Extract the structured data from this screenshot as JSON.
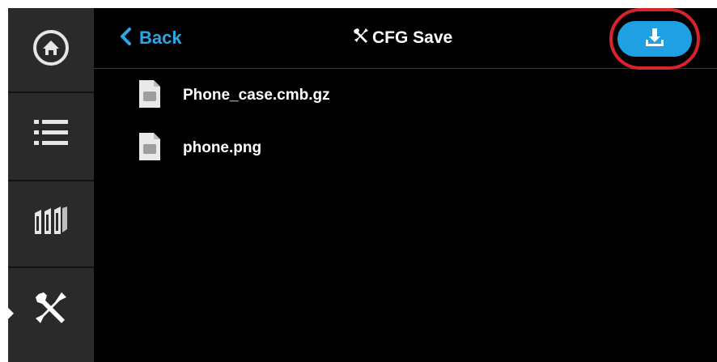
{
  "sidebar": {
    "items": [
      {
        "icon": "home-icon"
      },
      {
        "icon": "list-icon"
      },
      {
        "icon": "material-icon"
      },
      {
        "icon": "tools-icon",
        "active": true
      }
    ]
  },
  "header": {
    "back_label": "Back",
    "title": "CFG Save",
    "download_icon": "download-icon"
  },
  "files": [
    {
      "name": "Phone_case.cmb.gz",
      "icon": "file-icon"
    },
    {
      "name": "phone.png",
      "icon": "file-icon"
    }
  ],
  "colors": {
    "accent": "#1fa0e3",
    "highlight_ring": "#d8232a",
    "sidebar_bg": "#2a2a2a",
    "screen_bg": "#000000"
  }
}
